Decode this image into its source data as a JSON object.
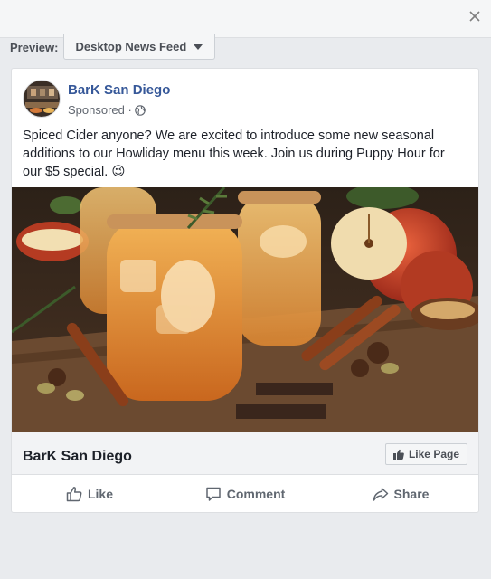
{
  "dialog": {
    "close_icon": "close-icon"
  },
  "preview": {
    "label": "Preview:",
    "selected": "Desktop News Feed",
    "icon": "caret-down-icon"
  },
  "post": {
    "page_name": "BarK San Diego",
    "sponsored": "Sponsored · ",
    "privacy_icon": "globe-icon",
    "text": "Spiced Cider anyone? We are excited to introduce some new seasonal additions to our Howliday menu this week. Join us during Puppy Hour for our $5 special. 😉",
    "image": "spiced-cider-drinks-photo",
    "link_title": "BarK San Diego",
    "like_page": "Like Page"
  },
  "actions": {
    "like": "Like",
    "comment": "Comment",
    "share": "Share"
  },
  "colors": {
    "page_bg": "#e9ebee",
    "link_blue": "#365899",
    "text": "#1d2129",
    "muted": "#606770"
  }
}
